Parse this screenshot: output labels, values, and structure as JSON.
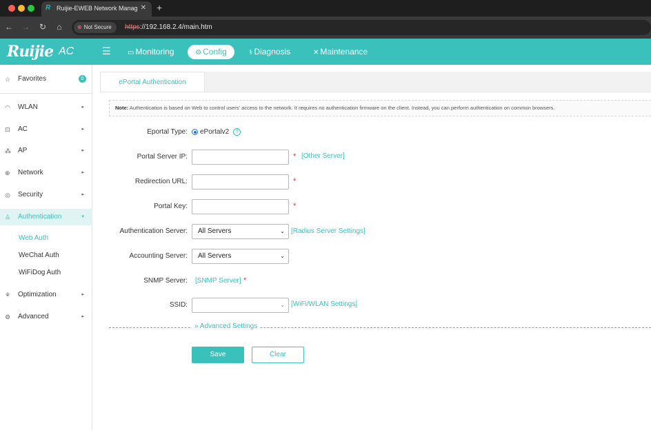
{
  "browser": {
    "tab_title": "Ruijie-EWEB Network Manag",
    "tab_favicon": "R",
    "security_label": "Not Secure",
    "url_protocol": "https",
    "url_rest": "://192.168.2.4/main.htm"
  },
  "header": {
    "logo": "Ruijie",
    "product": "AC",
    "nav": [
      {
        "label": "Monitoring",
        "icon": "monitor-icon"
      },
      {
        "label": "Config",
        "icon": "gear-icon",
        "active": true
      },
      {
        "label": "Diagnosis",
        "icon": "stethoscope-icon"
      },
      {
        "label": "Maintenance",
        "icon": "tools-icon"
      }
    ]
  },
  "sidebar": {
    "favorites": {
      "label": "Favorites",
      "badge": "0"
    },
    "items": [
      {
        "label": "WLAN",
        "icon": "wifi-icon"
      },
      {
        "label": "AC",
        "icon": "ac-icon"
      },
      {
        "label": "AP",
        "icon": "ap-icon"
      },
      {
        "label": "Network",
        "icon": "globe-icon"
      },
      {
        "label": "Security",
        "icon": "shield-icon"
      },
      {
        "label": "Authentication",
        "icon": "user-icon",
        "active": true
      },
      {
        "label": "Optimization",
        "icon": "optimize-icon"
      },
      {
        "label": "Advanced",
        "icon": "gear-icon"
      }
    ],
    "auth_subitems": [
      "Web Auth",
      "WeChat Auth",
      "WiFiDog Auth"
    ]
  },
  "main": {
    "tab": "ePortal Authentication",
    "note_label": "Note:",
    "note_text": "Authentication is based on Web to control users' access to the network. It requires no authentication firmware on the client. Instead, you can perform authentication on common browsers.",
    "form": {
      "eportal_type_label": "Eportal Type:",
      "eportal_type_value": "ePortalv2",
      "portal_server_ip_label": "Portal Server IP:",
      "portal_server_ip_value": "",
      "other_server_link": "[Other Server]",
      "redirection_url_label": "Redirection URL:",
      "redirection_url_value": "",
      "portal_key_label": "Portal Key:",
      "portal_key_value": "",
      "auth_server_label": "Authentication Server:",
      "auth_server_value": "All Servers",
      "radius_link": "[Radius Server Settings]",
      "accounting_server_label": "Accounting Server:",
      "accounting_server_value": "All Servers",
      "snmp_server_label": "SNMP Server:",
      "snmp_link": "[SNMP Server]",
      "ssid_label": "SSID:",
      "ssid_value": "",
      "wifi_link": "[WiFi/WLAN Settings]",
      "required_mark": "*",
      "advanced_settings": "Advanced Settings"
    },
    "buttons": {
      "save": "Save",
      "clear": "Clear"
    }
  },
  "colors": {
    "accent": "#3ac1bc",
    "required": "#e02f2f"
  }
}
